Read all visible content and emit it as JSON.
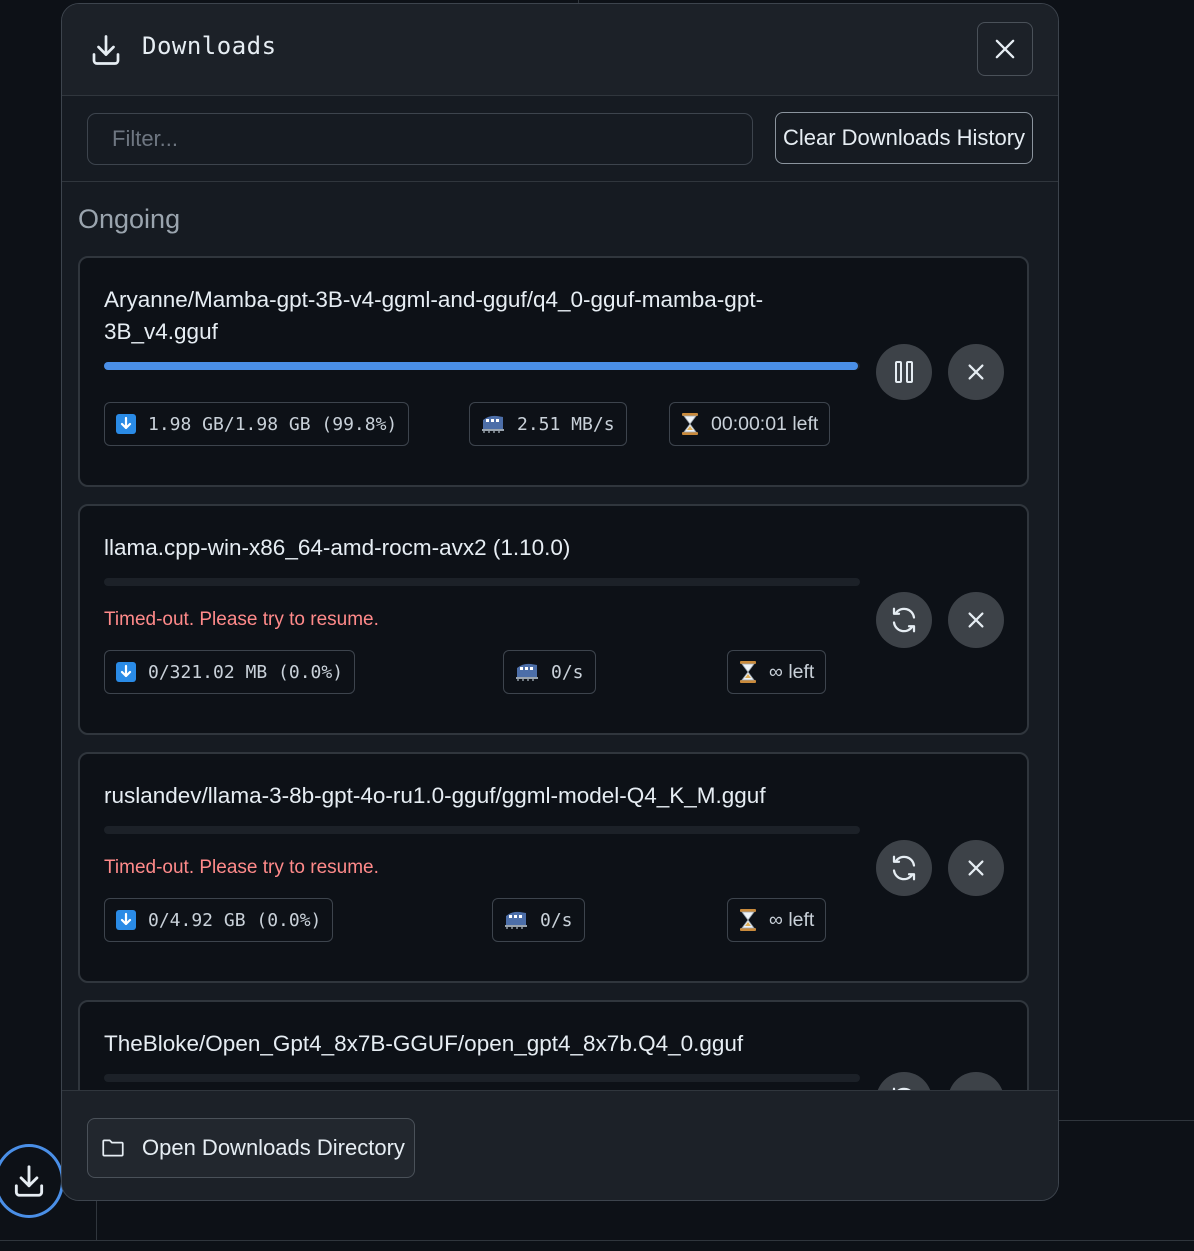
{
  "header": {
    "title": "Downloads"
  },
  "filter": {
    "placeholder": "Filter..."
  },
  "toolbar": {
    "clear_label": "Clear Downloads History"
  },
  "section": {
    "title": "Ongoing"
  },
  "downloads": [
    {
      "title": "Aryanne/Mamba-gpt-3B-v4-ggml-and-gguf/q4_0-gguf-mamba-gpt-3B_v4.gguf",
      "progress_percent": 99.8,
      "status": "",
      "size": "1.98 GB/1.98 GB (99.8%)",
      "speed": "2.51 MB/s",
      "eta": "00:00:01 left",
      "primary_action": "pause"
    },
    {
      "title": "llama.cpp-win-x86_64-amd-rocm-avx2 (1.10.0)",
      "progress_percent": 0.0,
      "status": "Timed-out. Please try to resume.",
      "size": "0/321.02 MB (0.0%)",
      "speed": "0/s",
      "eta": "∞ left",
      "primary_action": "resume"
    },
    {
      "title": "ruslandev/llama-3-8b-gpt-4o-ru1.0-gguf/ggml-model-Q4_K_M.gguf",
      "progress_percent": 0.0,
      "status": "Timed-out. Please try to resume.",
      "size": "0/4.92 GB (0.0%)",
      "speed": "0/s",
      "eta": "∞ left",
      "primary_action": "resume"
    },
    {
      "title": "TheBloke/Open_Gpt4_8x7B-GGUF/open_gpt4_8x7b.Q4_0.gguf",
      "progress_percent": 0.0,
      "status": "",
      "size": "",
      "speed": "",
      "eta": "",
      "primary_action": "resume"
    }
  ],
  "footer": {
    "open_dir_label": "Open Downloads Directory"
  },
  "icons": {
    "size": "down-arrow-box-icon",
    "speed": "train-icon",
    "eta": "hourglass-icon"
  },
  "colors": {
    "accent": "#4a8fe7",
    "error": "#ff8a8a",
    "background": "#0d1117",
    "panel": "#161b22"
  }
}
